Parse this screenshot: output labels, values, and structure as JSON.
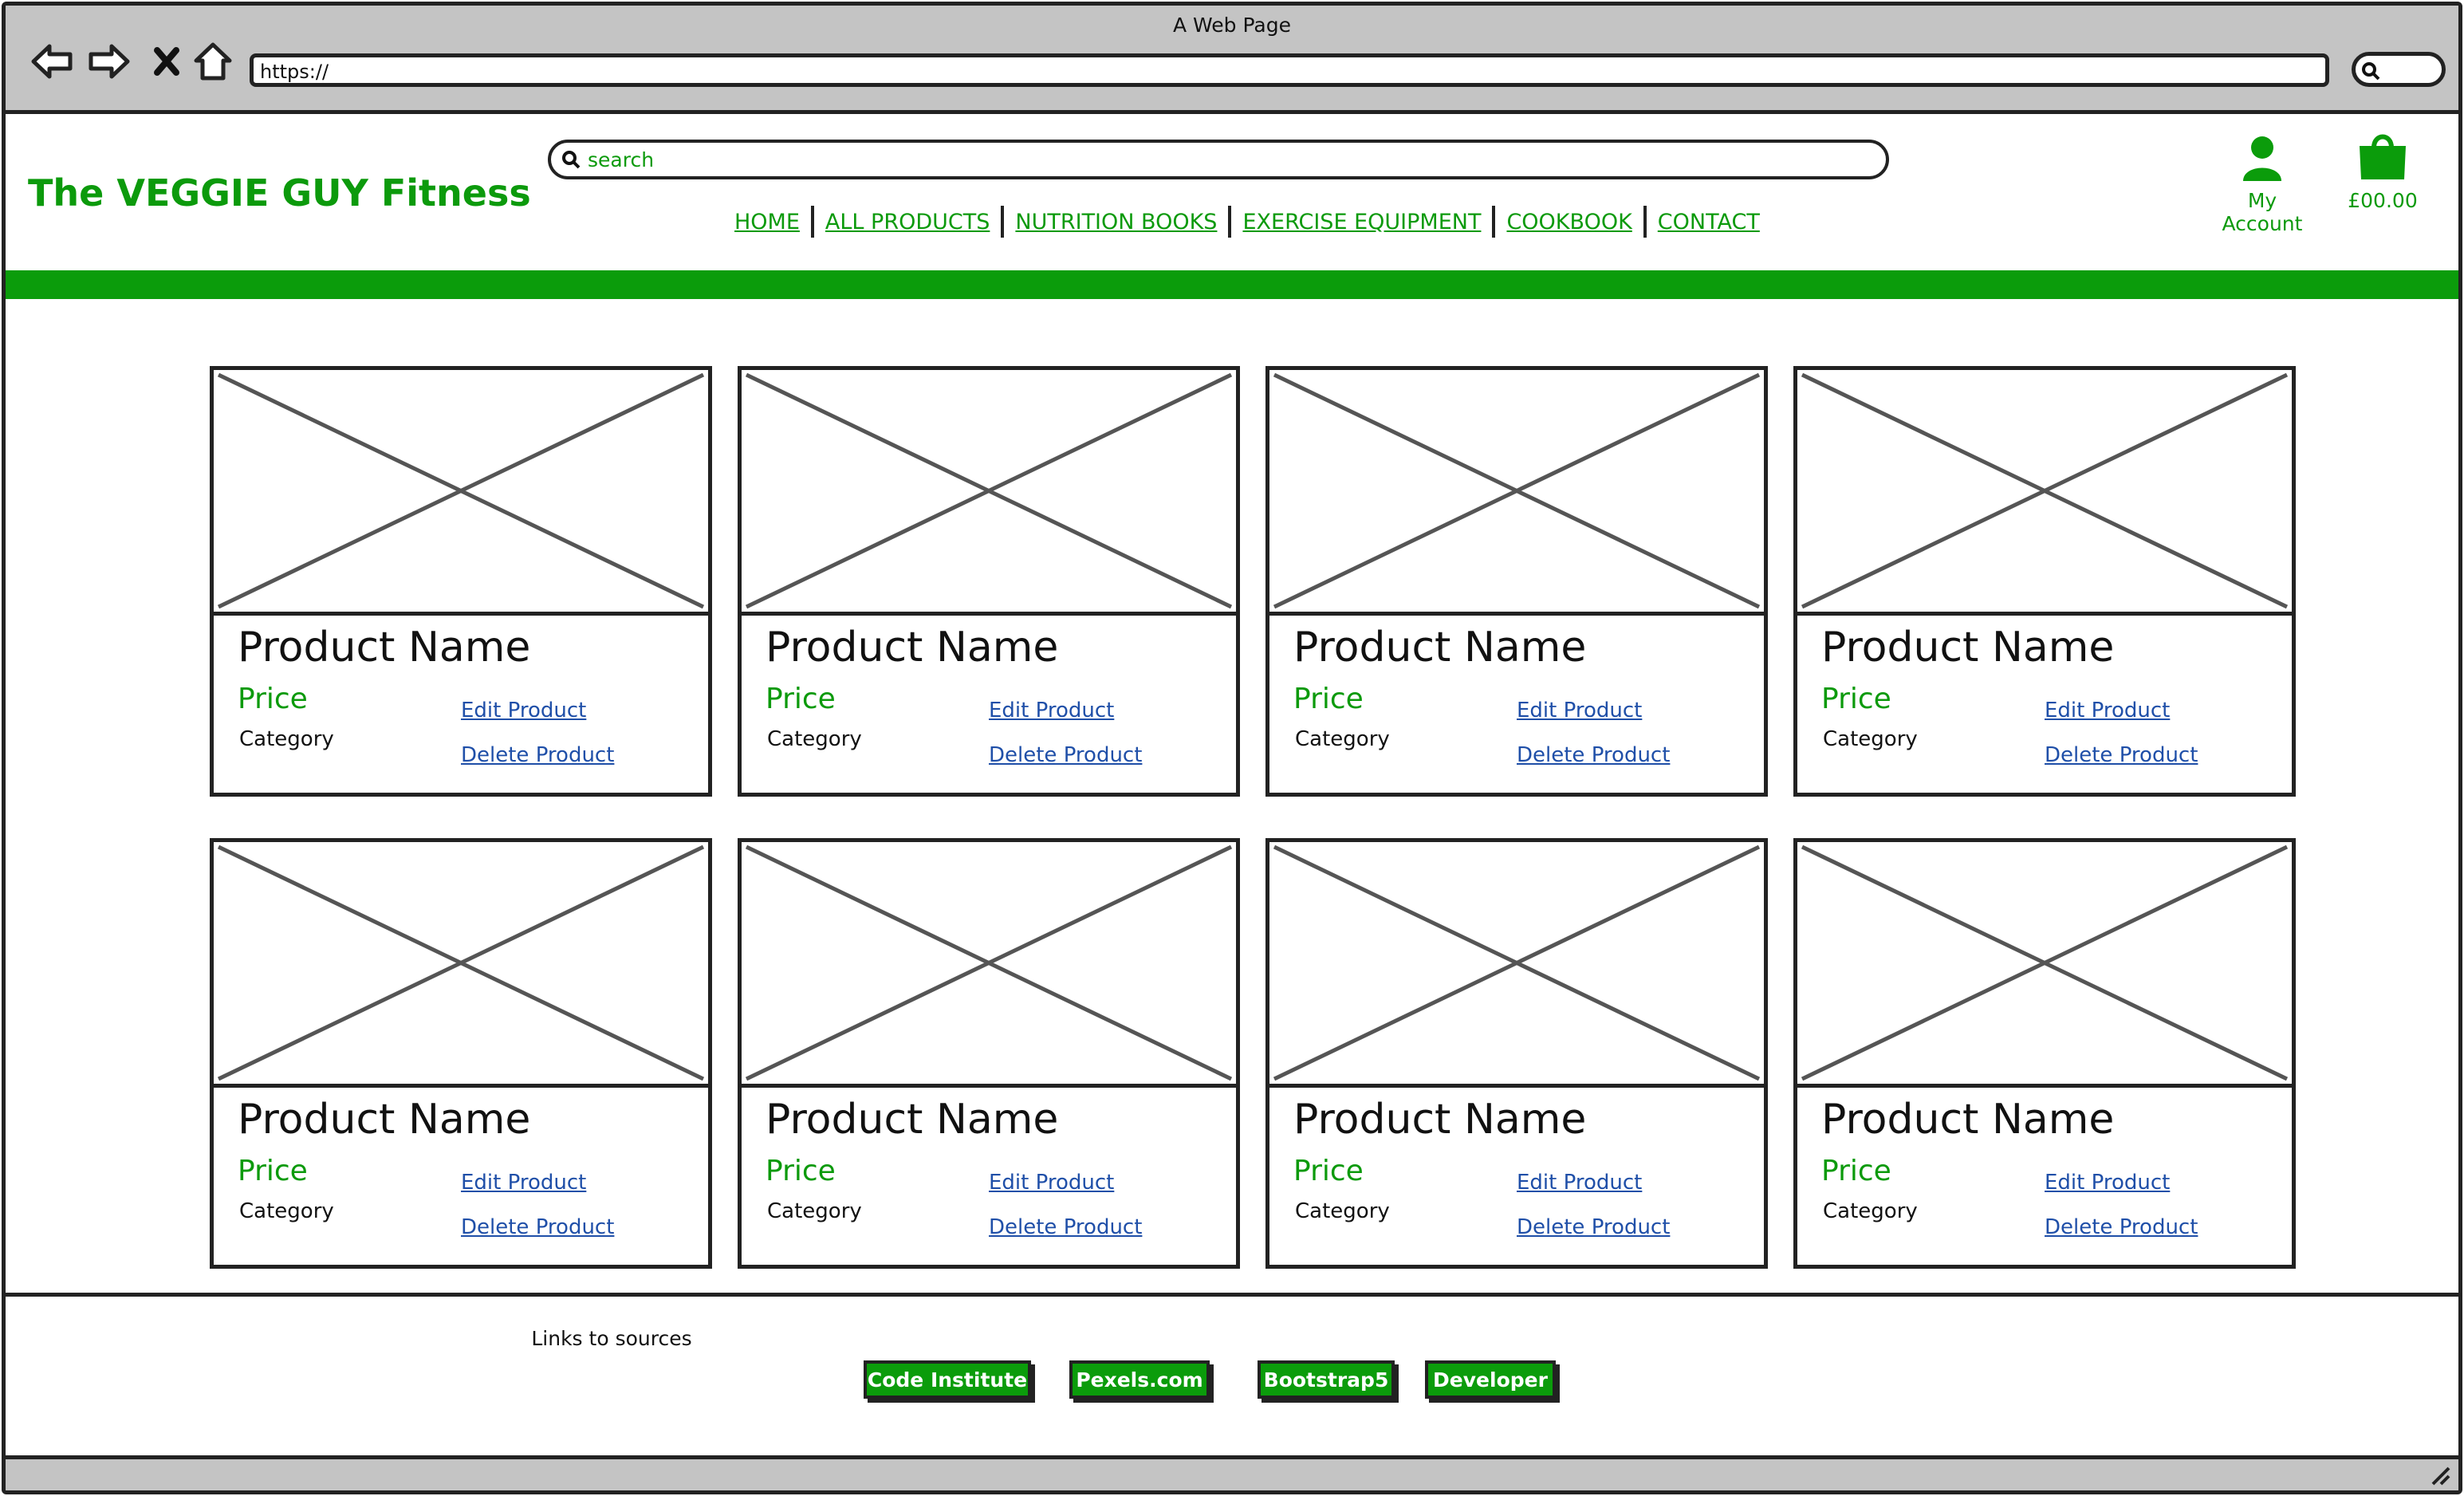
{
  "browser": {
    "title": "A Web Page",
    "url": "https://",
    "back_icon": "back-arrow-icon",
    "forward_icon": "forward-arrow-icon",
    "stop_icon": "close-icon",
    "home_icon": "home-icon"
  },
  "site": {
    "brand": "The VEGGIE GUY Fitness",
    "search_placeholder": "search",
    "nav": [
      "HOME",
      "ALL PRODUCTS",
      "NUTRITION BOOKS",
      "EXERCISE EQUIPMENT",
      "COOKBOOK",
      "CONTACT"
    ],
    "account_label": "My Account",
    "cart_total": "£00.00"
  },
  "colors": {
    "brand_green": "#0c9a0c",
    "link_blue": "#1f4fa8"
  },
  "products": [
    {
      "name": "Product Name",
      "price": "Price",
      "category": "Category",
      "edit": "Edit Product",
      "delete": "Delete Product"
    },
    {
      "name": "Product Name",
      "price": "Price",
      "category": "Category",
      "edit": "Edit Product",
      "delete": "Delete Product"
    },
    {
      "name": "Product Name",
      "price": "Price",
      "category": "Category",
      "edit": "Edit Product",
      "delete": "Delete Product"
    },
    {
      "name": "Product Name",
      "price": "Price",
      "category": "Category",
      "edit": "Edit Product",
      "delete": "Delete Product"
    },
    {
      "name": "Product Name",
      "price": "Price",
      "category": "Category",
      "edit": "Edit Product",
      "delete": "Delete Product"
    },
    {
      "name": "Product Name",
      "price": "Price",
      "category": "Category",
      "edit": "Edit Product",
      "delete": "Delete Product"
    },
    {
      "name": "Product Name",
      "price": "Price",
      "category": "Category",
      "edit": "Edit Product",
      "delete": "Delete Product"
    },
    {
      "name": "Product Name",
      "price": "Price",
      "category": "Category",
      "edit": "Edit Product",
      "delete": "Delete Product"
    }
  ],
  "footer": {
    "title": "Links to sources",
    "links": [
      "Code Institute",
      "Pexels.com",
      "Bootstrap5",
      "Developer"
    ]
  }
}
